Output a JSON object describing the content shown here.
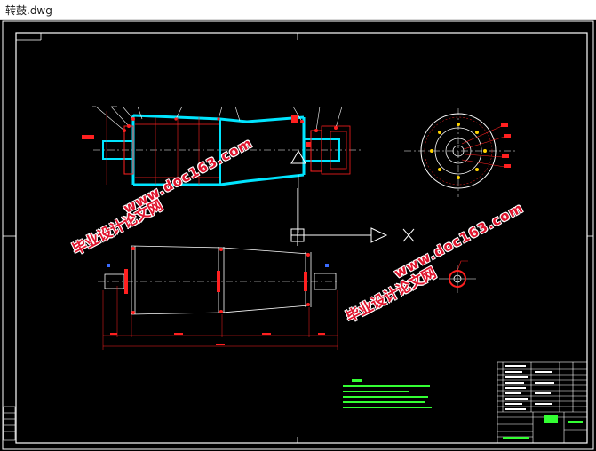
{
  "window": {
    "title": "转鼓.dwg"
  },
  "watermarks": {
    "cn_text": "毕业设计论文网",
    "url_text": "www.doc163.com"
  },
  "colors": {
    "background": "#000000",
    "frame": "#ffffff",
    "part_outline": "#00e5ff",
    "leader": "#ff2020",
    "dimension": "#ff2020",
    "notes": "#33ff33",
    "watermark": "#e0142d"
  }
}
